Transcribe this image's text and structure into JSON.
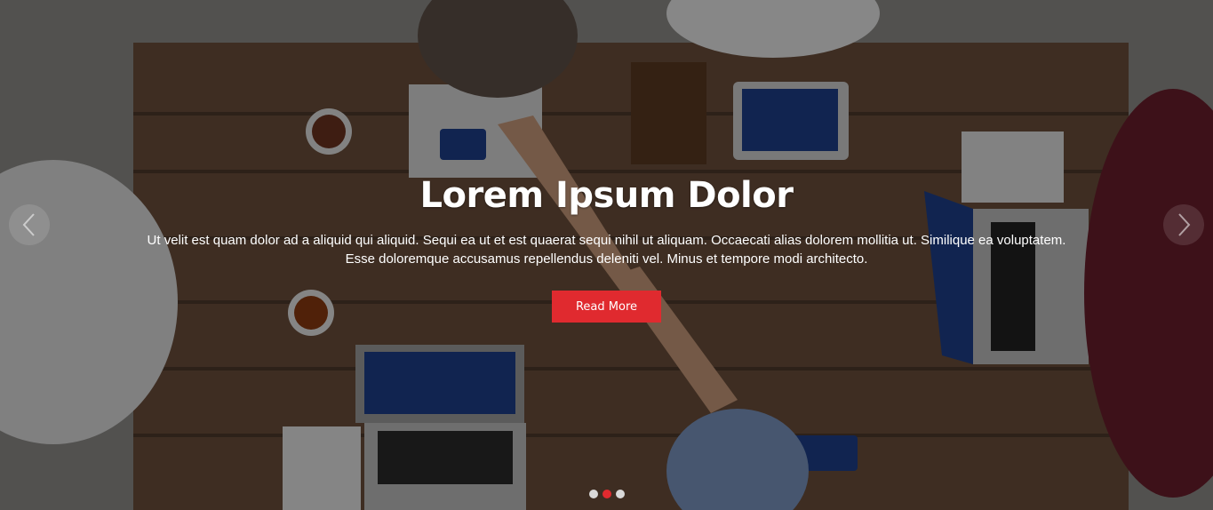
{
  "slider": {
    "title": "Lorem Ipsum Dolor",
    "description": "Ut velit est quam dolor ad a aliquid qui aliquid. Sequi ea ut et est quaerat sequi nihil ut aliquam. Occaecati alias dolorem mollitia ut. Similique ea voluptatem. Esse doloremque accusamus repellendus deleniti vel. Minus et tempore modi architecto.",
    "button_label": "Read More",
    "prev_icon": "chevron-left-icon",
    "next_icon": "chevron-right-icon",
    "slide_count": 3,
    "active_slide": 2,
    "colors": {
      "accent": "#e02a2f",
      "dot_inactive": "#d9d9d9",
      "text": "#ffffff"
    }
  }
}
